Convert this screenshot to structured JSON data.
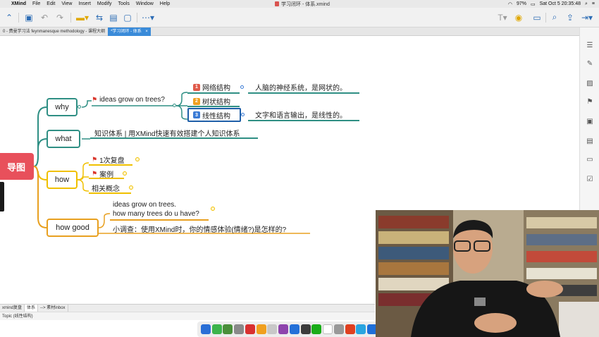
{
  "menubar": {
    "app": "XMind",
    "items": [
      "File",
      "Edit",
      "View",
      "Insert",
      "Modify",
      "Tools",
      "Window",
      "Help"
    ],
    "window_title": "学习闭环 - 体系.xmind",
    "battery": "97%",
    "datetime": "Sat Oct 5  20:35:48"
  },
  "tabs": [
    {
      "label": "0 - 费曼学习法 feynmanesque methodology - 课程大纲",
      "active": false
    },
    {
      "label": "*学习闭环 - 体系",
      "active": true,
      "close": "×"
    }
  ],
  "mindmap": {
    "central": "导图",
    "branches": [
      {
        "label": "why",
        "color": "#2f8f84"
      },
      {
        "label": "what",
        "color": "#2f8f84"
      },
      {
        "label": "how",
        "color": "#f0c000"
      },
      {
        "label": "how good",
        "color": "#e8a020"
      }
    ],
    "why_child": "ideas grow on trees?",
    "why_subs": [
      {
        "num": "1",
        "label": "网络结构",
        "num_color": "#e05a4a",
        "note": "人脑的神经系统，是网状的。"
      },
      {
        "num": "2",
        "label": "树状结构",
        "num_color": "#f0a020"
      },
      {
        "num": "3",
        "label": "线性结构",
        "num_color": "#3a7bd5",
        "note": "文字和语言输出，是线性的。"
      }
    ],
    "what_child": "知识体系 | 用XMind快速有效搭建个人知识体系",
    "how_children": [
      "1次复盘",
      "案例",
      "相关概念"
    ],
    "how_good_upper": [
      "ideas grow on trees.",
      "how many trees do u have?"
    ],
    "how_good_lower": "小调查：使用XMind时，你的情感体验(情绪?)是怎样的?"
  },
  "sheets": [
    {
      "label": "xmind复盘",
      "active": false
    },
    {
      "label": "体系",
      "active": true
    },
    {
      "label": "--> 素材inbox",
      "active": false
    }
  ],
  "status": "Topic (线性结构)",
  "colors": {
    "accent": "#3a8bd9",
    "central": "#e8505b",
    "teal": "#2f8f84",
    "yellow": "#f0c000",
    "orange": "#e8a020",
    "selected": "#1f5fa8"
  }
}
